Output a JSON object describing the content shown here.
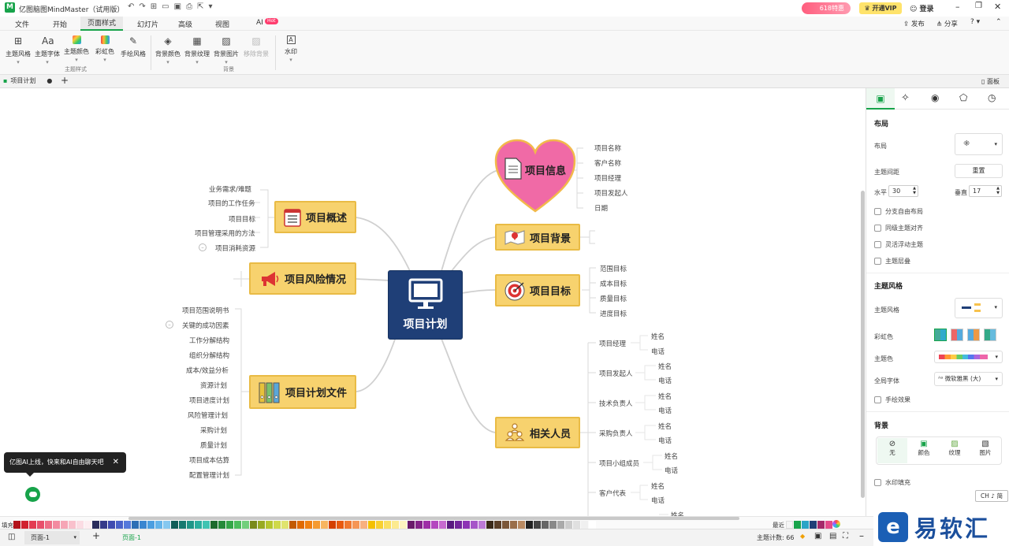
{
  "app": {
    "title": "亿图脑图MindMaster（试用版）",
    "promo": "618特惠",
    "vip": "开通VIP",
    "login": "登录"
  },
  "menu": {
    "items": [
      "文件",
      "开始",
      "页面样式",
      "幻灯片",
      "高级",
      "视图",
      "AI"
    ],
    "ai_badge": "Hot",
    "publish": "发布",
    "share": "分享"
  },
  "ribbon": {
    "group1": [
      "主题风格",
      "主题字体",
      "主题颜色",
      "彩虹色",
      "手绘风格"
    ],
    "group1_label": "主题样式",
    "group2": [
      "背景颜色",
      "背景纹理",
      "背景图片",
      "移除背景"
    ],
    "group2_label": "背景",
    "group3": [
      "水印"
    ]
  },
  "doc": {
    "tab": "项目计划",
    "panel_toggle": "面板"
  },
  "mindmap": {
    "root": "项目计划",
    "overview": {
      "title": "项目概述",
      "items": [
        "业务需求/难题",
        "项目的工作任务",
        "项目目标",
        "项目管理采用的方法",
        "项目消耗资源"
      ]
    },
    "risk": {
      "title": "项目风险情况"
    },
    "files": {
      "title": "项目计划文件",
      "items": [
        "项目范围说明书",
        "关键的成功因素",
        "工作分解结构",
        "组织分解结构",
        "成本/效益分析",
        "资源计划",
        "项目进度计划",
        "风险管理计划",
        "采购计划",
        "质量计划",
        "项目成本估算",
        "配置管理计划"
      ]
    },
    "info": {
      "title": "项目信息",
      "items": [
        "项目名称",
        "客户名称",
        "项目经理",
        "项目发起人",
        "日期"
      ]
    },
    "background": {
      "title": "项目背景"
    },
    "goal": {
      "title": "项目目标",
      "items": [
        "范围目标",
        "成本目标",
        "质量目标",
        "进度目标"
      ]
    },
    "people": {
      "title": "相关人员",
      "roles": [
        "项目经理",
        "项目发起人",
        "技术负责人",
        "采购负责人",
        "项目小组成员",
        "客户代表"
      ],
      "name": "姓名",
      "phone": "电话",
      "cut": "姓名"
    }
  },
  "ai_tip": "亿图AI上线，快来和AI自由聊天吧",
  "panel": {
    "layout_h": "布局",
    "layout": "布局",
    "spacing": "主题间距",
    "reset": "重置",
    "horizontal": "水平",
    "h_value": "30",
    "vertical": "垂直",
    "v_value": "17",
    "checks1": [
      "分支自由布局",
      "同级主题对齐",
      "灵活浮动主题",
      "主题层叠"
    ],
    "style_h": "主题风格",
    "style": "主题风格",
    "rainbow": "彩虹色",
    "theme_color": "主题色",
    "font": "全局字体",
    "font_value": "微软雅黑 (大)",
    "hand": "手绘效果",
    "bg_h": "背景",
    "bg_opts": [
      "无",
      "颜色",
      "纹理",
      "图片"
    ],
    "watermark": "水印填充",
    "ime": "CH ♪ 简"
  },
  "palette": {
    "fill": "填充",
    "recent": "最近"
  },
  "status": {
    "page_select": "页面-1",
    "page_tab": "页面-1",
    "topic_count": "主题计数: 66"
  },
  "brand": "易软汇",
  "colors": {
    "topic": "#f7d26e",
    "root": "#1f3f77",
    "heart": "#f06aa6",
    "accent": "#17a34a"
  }
}
